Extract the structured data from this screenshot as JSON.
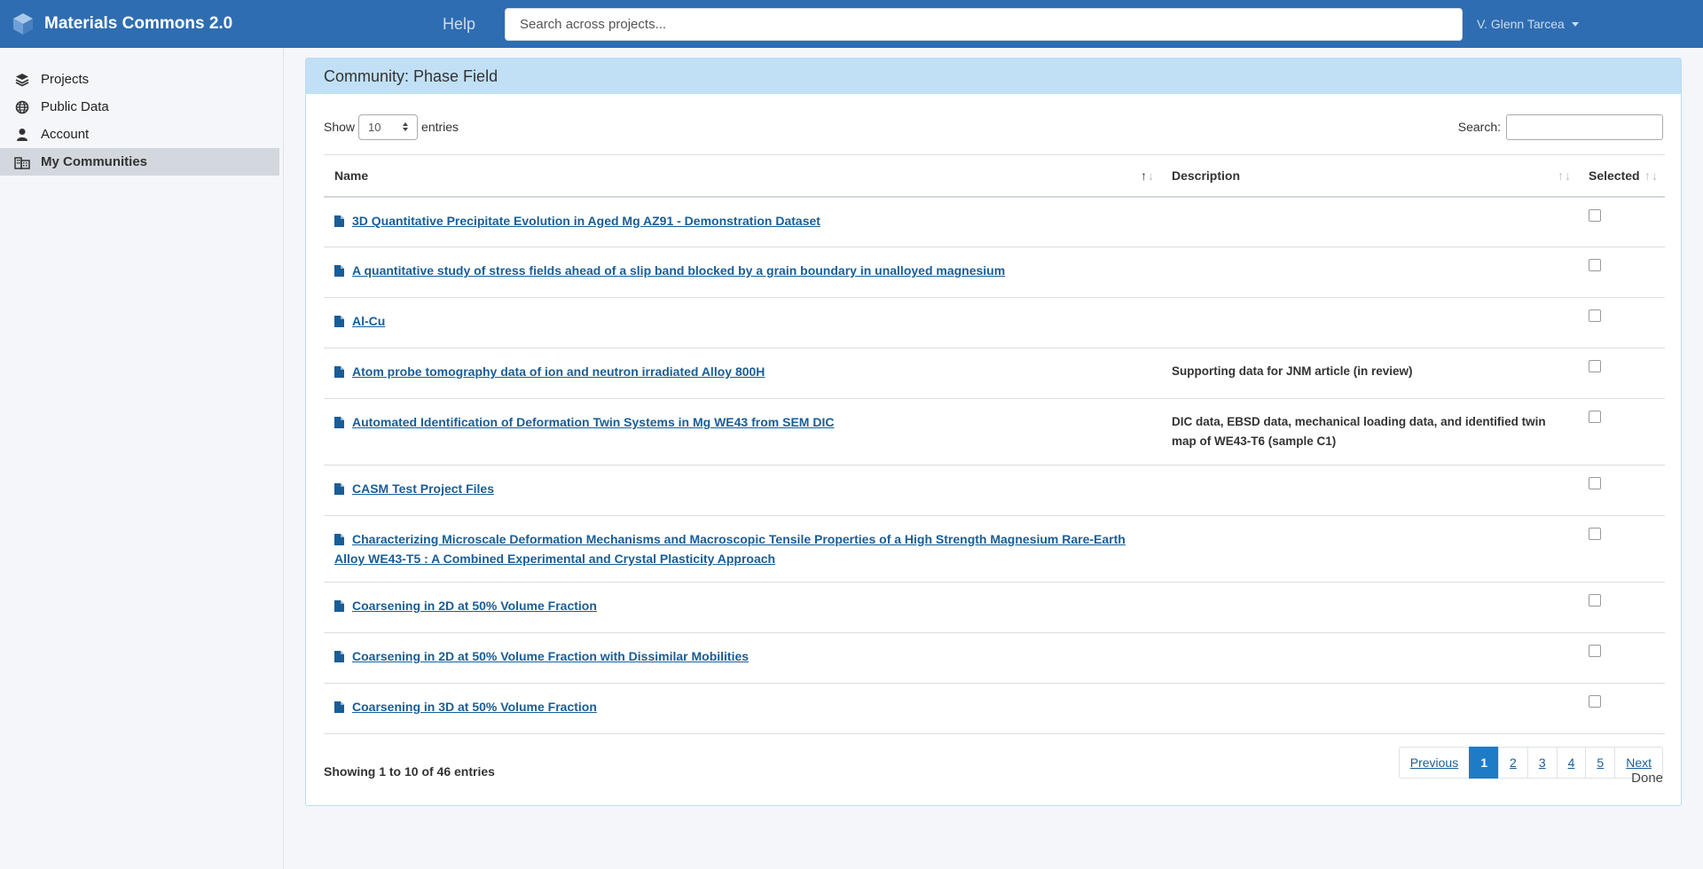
{
  "app": {
    "title": "Materials Commons 2.0",
    "help": "Help",
    "search_placeholder": "Search across projects...",
    "user": "V. Glenn Tarcea"
  },
  "sidebar": {
    "items": [
      {
        "label": "Projects",
        "icon": "layers-icon"
      },
      {
        "label": "Public Data",
        "icon": "globe-icon"
      },
      {
        "label": "Account",
        "icon": "user-icon"
      },
      {
        "label": "My Communities",
        "icon": "building-icon",
        "active": true
      }
    ]
  },
  "panel": {
    "title": "Community: Phase Field",
    "show_label": "Show",
    "show_value": "10",
    "entries_label": "entries",
    "search_label": "Search:",
    "columns": {
      "name": "Name",
      "description": "Description",
      "selected": "Selected"
    },
    "rows": [
      {
        "name": "3D Quantitative Precipitate Evolution in Aged Mg AZ91 - Demonstration Dataset",
        "description": ""
      },
      {
        "name": "A quantitative study of stress fields ahead of a slip band blocked by a grain boundary in unalloyed magnesium",
        "description": ""
      },
      {
        "name": "Al-Cu",
        "description": ""
      },
      {
        "name": "Atom probe tomography data of ion and neutron irradiated Alloy 800H",
        "description": "Supporting data for JNM article (in review)"
      },
      {
        "name": "Automated Identification of Deformation Twin Systems in Mg WE43 from SEM DIC",
        "description": "DIC data, EBSD data, mechanical loading data, and identified twin map of WE43-T6 (sample C1)"
      },
      {
        "name": "CASM Test Project Files",
        "description": ""
      },
      {
        "name": "Characterizing Microscale Deformation Mechanisms and Macroscopic Tensile Properties of a High Strength Magnesium Rare-Earth Alloy WE43-T5 : A Combined Experimental and Crystal Plasticity Approach",
        "description": ""
      },
      {
        "name": "Coarsening in 2D at 50% Volume Fraction",
        "description": ""
      },
      {
        "name": "Coarsening in 2D at 50% Volume Fraction with Dissimilar Mobilities",
        "description": ""
      },
      {
        "name": "Coarsening in 3D at 50% Volume Fraction",
        "description": ""
      }
    ],
    "info": "Showing 1 to 10 of 46 entries",
    "pager": {
      "previous": "Previous",
      "pages": [
        "1",
        "2",
        "3",
        "4",
        "5"
      ],
      "current": "1",
      "next": "Next"
    },
    "done": "Done"
  },
  "colors": {
    "topbar": "#2e6db1",
    "panel_header": "#c1e0f6",
    "link": "#1a5d96",
    "active_page": "#1e7bc6"
  }
}
